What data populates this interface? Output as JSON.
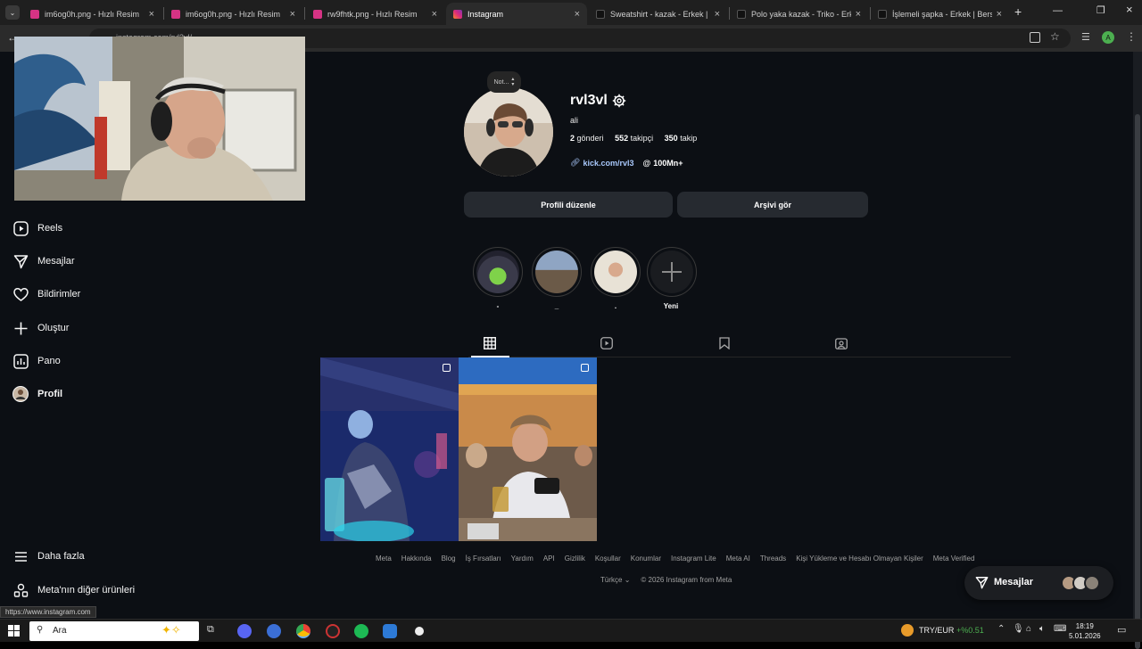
{
  "browser": {
    "tabs": [
      {
        "title": "im6og0h.png - Hızlı Resim",
        "icon_color": "#d63384"
      },
      {
        "title": "im6og0h.png - Hızlı Resim",
        "icon_color": "#d63384"
      },
      {
        "title": "rw9fhtk.png - Hızlı Resim",
        "icon_color": "#d63384"
      },
      {
        "title": "Instagram",
        "icon_color": "#e1306c"
      },
      {
        "title": "Sweatshirt - kazak - Erkek | Bers",
        "icon_color": "#111111"
      },
      {
        "title": "Polo yaka kazak - Triko - Erkek",
        "icon_color": "#111111"
      },
      {
        "title": "İşlemeli şapka - Erkek | Bershka",
        "icon_color": "#111111"
      }
    ],
    "url": "instagram.com/rvl3vl/",
    "profile_initial": "A",
    "status_url": "https://www.instagram.com"
  },
  "sidebar": {
    "items": [
      {
        "label": "Reels",
        "icon": "reels-icon"
      },
      {
        "label": "Mesajlar",
        "icon": "send-icon"
      },
      {
        "label": "Bildirimler",
        "icon": "heart-icon"
      },
      {
        "label": "Oluştur",
        "icon": "plus-icon"
      },
      {
        "label": "Pano",
        "icon": "dashboard-icon"
      },
      {
        "label": "Profil",
        "icon": "avatar"
      }
    ],
    "more_label": "Daha fazla",
    "meta_label": "Meta'nın diğer ürünleri"
  },
  "profile": {
    "note": "Not...",
    "username": "rvl3vl",
    "full_name": "ali",
    "posts_count": "2",
    "posts_label": "gönderi",
    "followers_count": "552",
    "followers_label": "takipçi",
    "following_count": "350",
    "following_label": "takip",
    "link": "kick.com/rvl3",
    "threads": "100Mn+",
    "edit_button": "Profili düzenle",
    "archive_button": "Arşivi gör"
  },
  "highlights": [
    {
      "label": "-"
    },
    {
      "label": "_"
    },
    {
      "label": "."
    },
    {
      "label": "Yeni"
    }
  ],
  "footer": {
    "links": [
      "Meta",
      "Hakkında",
      "Blog",
      "İş Fırsatları",
      "Yardım",
      "API",
      "Gizlilik",
      "Koşullar",
      "Konumlar",
      "Instagram Lite",
      "Meta AI",
      "Threads",
      "Kişi Yükleme ve Hesabı Olmayan Kişiler",
      "Meta Verified"
    ],
    "language": "Türkçe",
    "copyright": "© 2026 Instagram from Meta"
  },
  "messages_pill": {
    "label": "Mesajlar"
  },
  "taskbar": {
    "search_placeholder": "Ara",
    "currency": "TRY/EUR",
    "currency_change": "+%0.51",
    "time": "18:19",
    "date": "5.01.2026"
  },
  "colors": {
    "page_bg": "#0c0f14",
    "button_bg": "#262a30",
    "link": "#a8c7fa",
    "positive": "#4caf50"
  }
}
